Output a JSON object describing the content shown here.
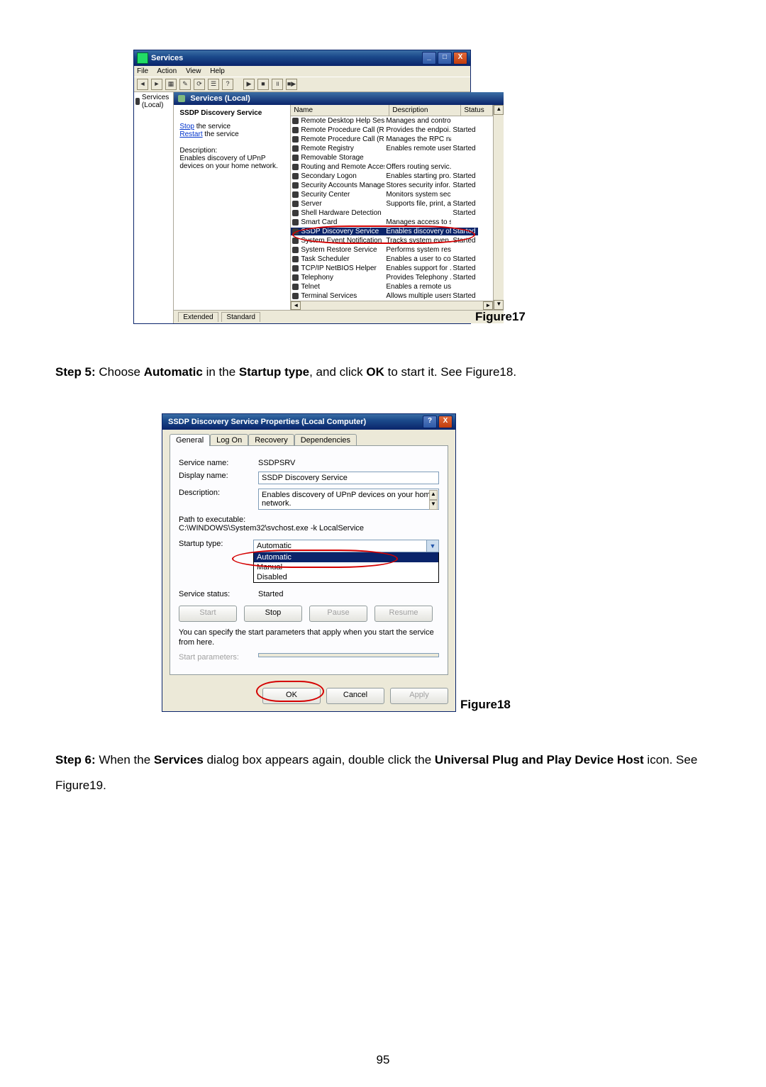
{
  "fig17_label": "Figure17",
  "fig18_label": "Figure18",
  "page_number": "95",
  "step5": {
    "prefix": "Step 5: ",
    "t1": "Choose ",
    "b1": "Automatic",
    "t2": " in the ",
    "b2": "Startup type",
    "t3": ", and click ",
    "b3": "OK",
    "t4": " to start it. See Figure18."
  },
  "step6": {
    "prefix": "Step 6: ",
    "t1": "When the ",
    "b1": "Services",
    "t2": " dialog box appears again, double click the ",
    "b2": "Universal Plug and Play Device Host",
    "t3": " icon. See Figure19."
  },
  "svc_win": {
    "title": "Services",
    "menu": {
      "file": "File",
      "action": "Action",
      "view": "View",
      "help": "Help"
    },
    "tree_root": "Services (Local)",
    "pane_header": "Services (Local)",
    "detail": {
      "name": "SSDP Discovery Service",
      "stop": "Stop",
      "stop_suffix": " the service",
      "restart": "Restart",
      "restart_suffix": " the service",
      "desc_label": "Description:",
      "desc_text": "Enables discovery of UPnP devices on your home network."
    },
    "cols": {
      "name": "Name",
      "desc": "Description",
      "status": "Status"
    },
    "rows": [
      {
        "n": "Remote Desktop Help Sessio...",
        "d": "Manages and contro...",
        "s": ""
      },
      {
        "n": "Remote Procedure Call (RPC)",
        "d": "Provides the endpoi...",
        "s": "Started"
      },
      {
        "n": "Remote Procedure Call (RPC)...",
        "d": "Manages the RPC na...",
        "s": ""
      },
      {
        "n": "Remote Registry",
        "d": "Enables remote user...",
        "s": "Started"
      },
      {
        "n": "Removable Storage",
        "d": "",
        "s": ""
      },
      {
        "n": "Routing and Remote Access",
        "d": "Offers routing servic...",
        "s": ""
      },
      {
        "n": "Secondary Logon",
        "d": "Enables starting pro...",
        "s": "Started"
      },
      {
        "n": "Security Accounts Manager",
        "d": "Stores security infor...",
        "s": "Started"
      },
      {
        "n": "Security Center",
        "d": "Monitors system sec...",
        "s": ""
      },
      {
        "n": "Server",
        "d": "Supports file, print, a...",
        "s": "Started"
      },
      {
        "n": "Shell Hardware Detection",
        "d": "",
        "s": "Started"
      },
      {
        "n": "Smart Card",
        "d": "Manages access to s...",
        "s": ""
      },
      {
        "n": "SSDP Discovery Service",
        "d": "Enables discovery of...",
        "s": "Started",
        "selected": true
      },
      {
        "n": "System Event Notification",
        "d": "Tracks system even...",
        "s": "Started"
      },
      {
        "n": "System Restore Service",
        "d": "Performs system res...",
        "s": ""
      },
      {
        "n": "Task Scheduler",
        "d": "Enables a user to co...",
        "s": "Started"
      },
      {
        "n": "TCP/IP NetBIOS Helper",
        "d": "Enables support for ...",
        "s": "Started"
      },
      {
        "n": "Telephony",
        "d": "Provides Telephony ...",
        "s": "Started"
      },
      {
        "n": "Telnet",
        "d": "Enables a remote us...",
        "s": ""
      },
      {
        "n": "Terminal Services",
        "d": "Allows multiple users ...",
        "s": "Started"
      }
    ],
    "tabs": {
      "extended": "Extended",
      "standard": "Standard"
    }
  },
  "props": {
    "title": "SSDP Discovery Service Properties (Local Computer)",
    "tabs": {
      "general": "General",
      "logon": "Log On",
      "recovery": "Recovery",
      "deps": "Dependencies"
    },
    "labels": {
      "service_name": "Service name:",
      "display_name": "Display name:",
      "description": "Description:",
      "path_label": "Path to executable:",
      "startup_type": "Startup type:",
      "service_status": "Service status:",
      "start_params": "Start parameters:"
    },
    "values": {
      "service_name": "SSDPSRV",
      "display_name": "SSDP Discovery Service",
      "description": "Enables discovery of UPnP devices on your home network.",
      "path": "C:\\WINDOWS\\System32\\svchost.exe -k LocalService",
      "startup_selection": "Automatic",
      "status": "Started"
    },
    "startup_options": [
      "Automatic",
      "Manual",
      "Disabled"
    ],
    "buttons": {
      "start": "Start",
      "stop": "Stop",
      "pause": "Pause",
      "resume": "Resume",
      "ok": "OK",
      "cancel": "Cancel",
      "apply": "Apply"
    },
    "note": "You can specify the start parameters that apply when you start the service from here."
  },
  "glyphs": {
    "min": "_",
    "max": "□",
    "close": "X",
    "help": "?",
    "left": "◄",
    "right": "►",
    "up": "▲",
    "down": "▼"
  }
}
